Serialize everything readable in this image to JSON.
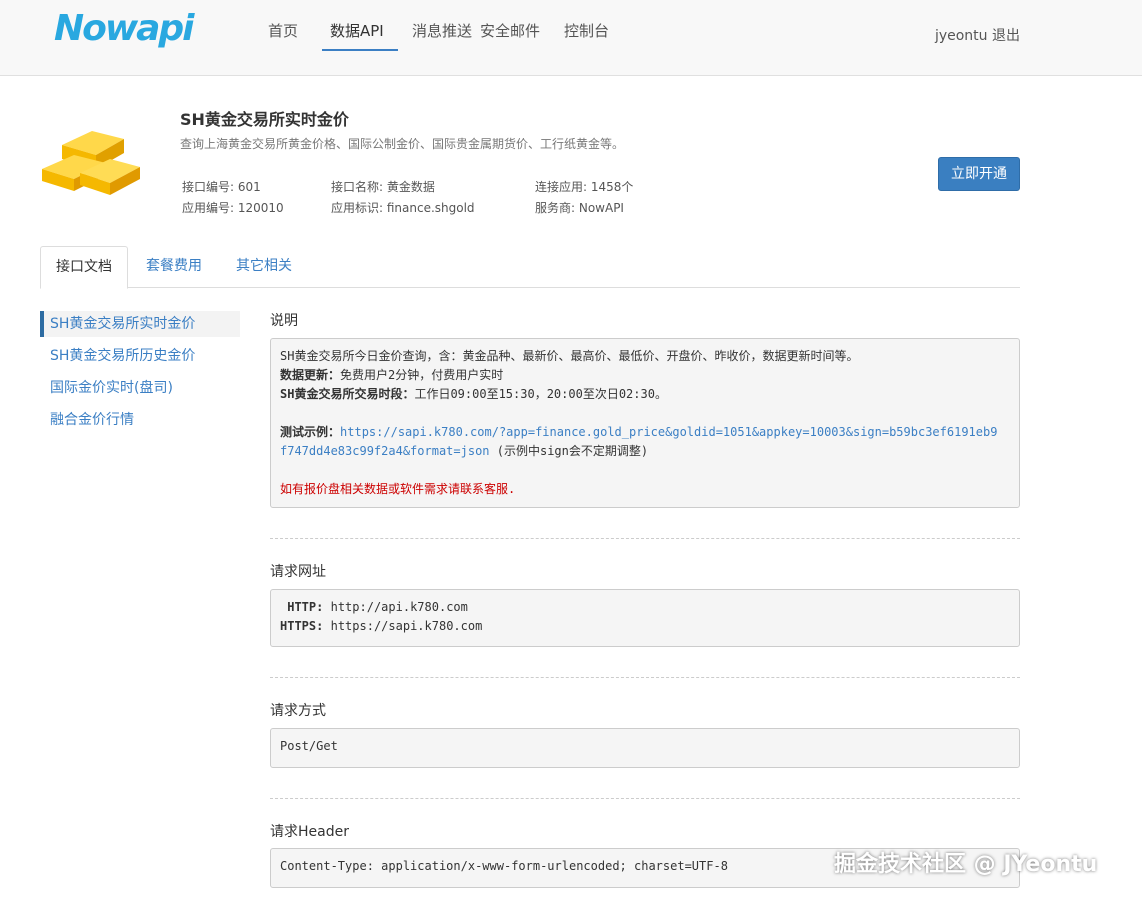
{
  "header": {
    "logo": "Nowapi",
    "nav": [
      "首页",
      "数据API",
      "消息推送",
      "安全邮件",
      "控制台"
    ],
    "active_nav": 1,
    "username": "jyeontu",
    "logout": "退出"
  },
  "api": {
    "title": "SH黄金交易所实时金价",
    "description": "查询上海黄金交易所黄金价格、国际公制金价、国际贵金属期货价、工行纸黄金等。",
    "meta": {
      "api_no": "接口编号: 601",
      "app_no": "应用编号: 120010",
      "api_name": "接口名称: 黄金数据",
      "app_id": "应用标识: finance.shgold",
      "connected": "连接应用: 1458个",
      "provider": "服务商: NowAPI"
    },
    "open_button": "立即开通"
  },
  "tabs": [
    "接口文档",
    "套餐费用",
    "其它相关"
  ],
  "sidebar": [
    "SH黄金交易所实时金价",
    "SH黄金交易所历史金价",
    "国际金价实时(盘司)",
    "融合金价行情"
  ],
  "sections": {
    "desc": {
      "title": "说明",
      "line1": "SH黄金交易所今日金价查询，含：黄金品种、最新价、最高价、最低价、开盘价、昨收价，数据更新时间等。",
      "update_label": "数据更新：",
      "update_text": "免费用户2分钟，付费用户实时",
      "session_label": "SH黄金交易所交易时段：",
      "session_text": "工作日09:00至15:30，20:00至次日02:30。",
      "example_label": "测试示例：",
      "example_url_1": "https://sapi.k780.com/?app=finance.gold_price&goldid=1051&appkey=10003&sign=b59bc3ef6191eb9",
      "example_url_2": "f747dd4e83c99f2a4&format=json",
      "example_note": "(示例中sign会不定期调整)",
      "contact": "如有报价盘相关数据或软件需求请联系客服."
    },
    "url": {
      "title": "请求网址",
      "http_label": "HTTP:",
      "http_value": "http://api.k780.com",
      "https_label": "HTTPS:",
      "https_value": "https://sapi.k780.com"
    },
    "method": {
      "title": "请求方式",
      "value": "Post/Get"
    },
    "header": {
      "title": "请求Header",
      "value": "Content-Type: application/x-www-form-urlencoded; charset=UTF-8"
    }
  },
  "watermark": "掘金技术社区 @ JYeontu"
}
